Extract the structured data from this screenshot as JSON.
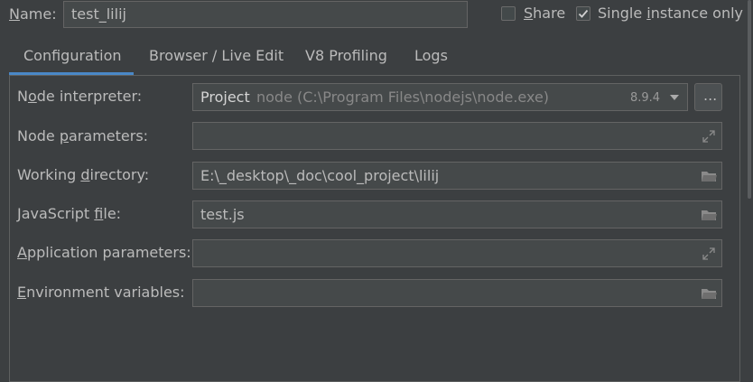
{
  "header": {
    "name_label_prefix": "N",
    "name_label_rest": "ame:",
    "name_value": "test_lilij",
    "share_label_prefix": "S",
    "share_label_rest": "hare",
    "share_checked": false,
    "single_prefix": "Single ",
    "single_mnemonic": "i",
    "single_rest": "nstance only",
    "single_checked": true
  },
  "tabs": [
    {
      "label": "Configuration"
    },
    {
      "label": "Browser / Live Edit"
    },
    {
      "label": "V8 Profiling"
    },
    {
      "label": "Logs"
    }
  ],
  "config": {
    "node_interpreter": {
      "label_a": "N",
      "label_b": "o",
      "label_c": "de interpreter:",
      "project": "Project",
      "path": "node (C:\\Program Files\\nodejs\\node.exe)",
      "version": "8.9.4",
      "browse": "..."
    },
    "node_parameters": {
      "label_a": "Node ",
      "label_b": "p",
      "label_c": "arameters:",
      "value": ""
    },
    "working_directory": {
      "label_a": "Working ",
      "label_b": "d",
      "label_c": "irectory:",
      "value": "E:\\_desktop\\_doc\\cool_project\\lilij"
    },
    "javascript_file": {
      "label_a": "JavaScript ",
      "label_b": "f",
      "label_c": "ile:",
      "value": "test.js"
    },
    "application_parameters": {
      "label_a": "A",
      "label_b": "pplication parameters:",
      "value": ""
    },
    "environment_variables": {
      "label_a": "E",
      "label_b": "nvironment variables:",
      "value": ""
    }
  },
  "colors": {
    "background": "#3c3f41",
    "field_bg": "#45494a",
    "border": "#646464",
    "tab_underline": "#4a88c7",
    "text": "#bbbbbb",
    "muted": "#888888"
  },
  "icons": {
    "expand": "expand-icon",
    "folder": "folder-icon",
    "dropdown": "chevron-down-icon",
    "checkmark": "checkmark-icon"
  }
}
